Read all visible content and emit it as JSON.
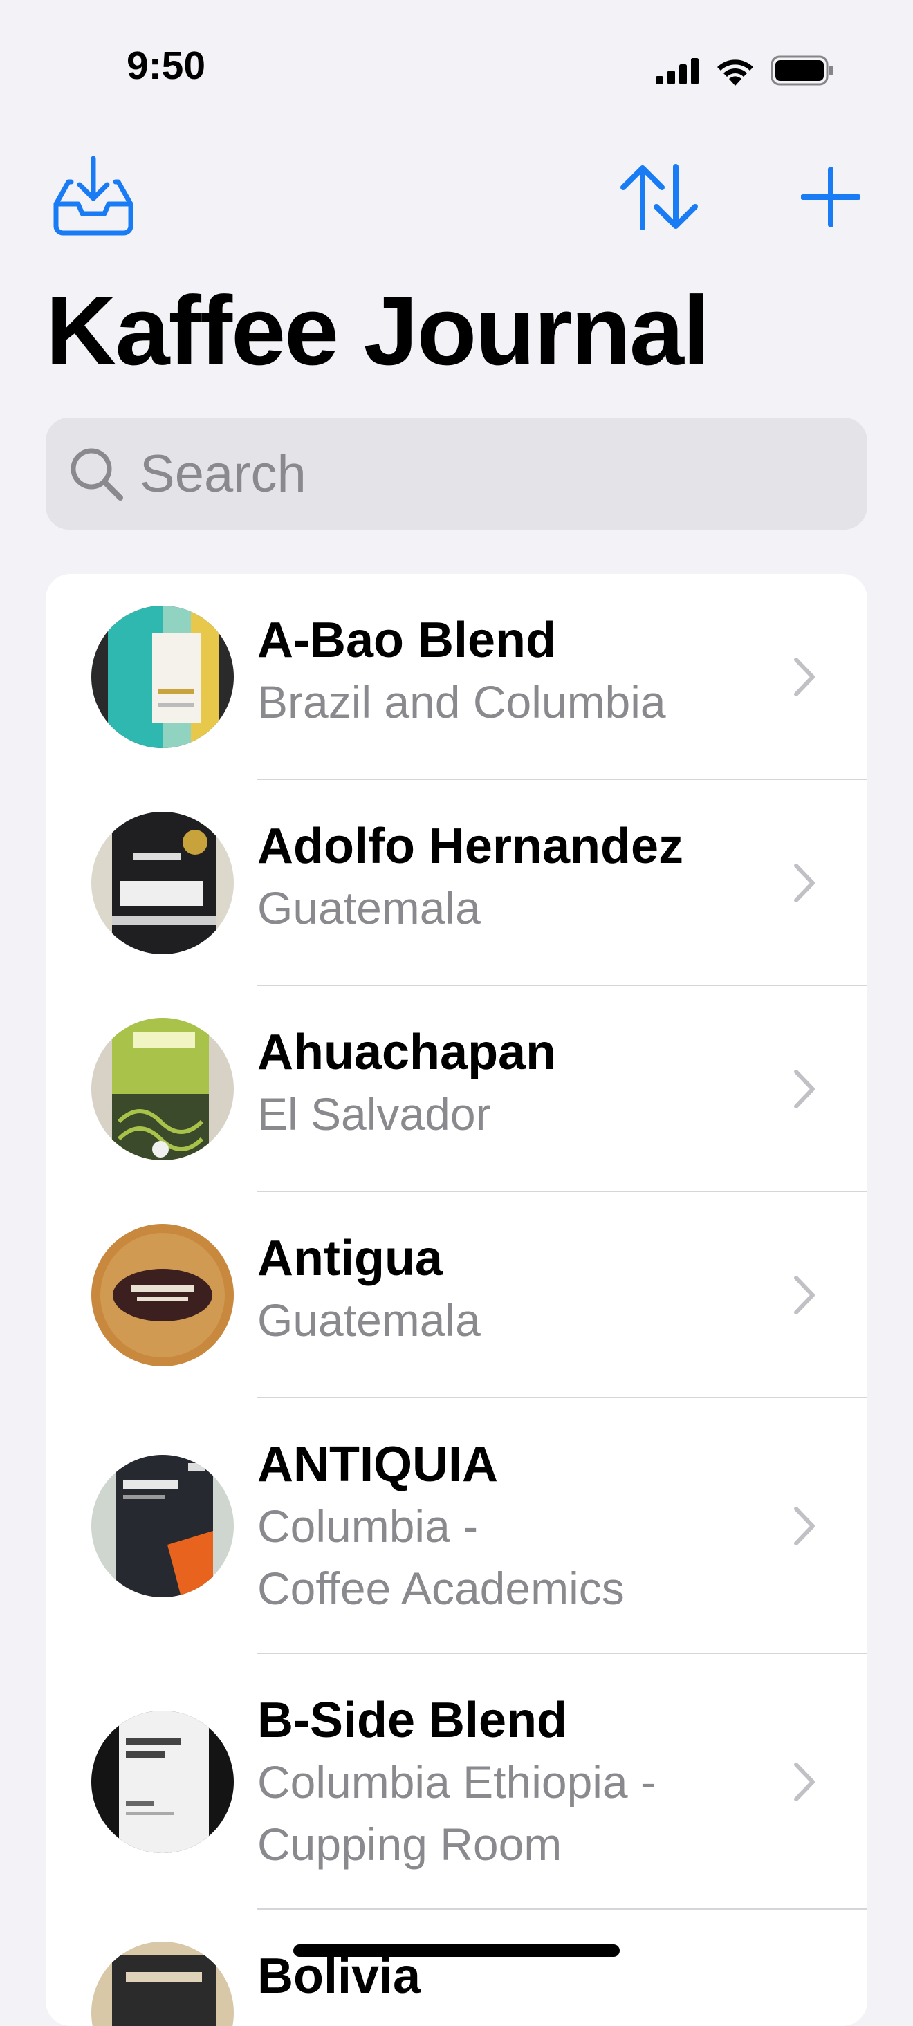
{
  "status_bar": {
    "time": "9:50"
  },
  "toolbar": {
    "import_icon": "tray-arrow-down-icon",
    "sort_icon": "arrow-up-arrow-down-icon",
    "add_icon": "plus-icon"
  },
  "title": "Kaffee Journal",
  "search": {
    "placeholder": "Search",
    "value": ""
  },
  "colors": {
    "accent": "#1a7cf5",
    "background": "#f2f2f7",
    "secondary_text": "#8a8a8e"
  },
  "coffees": [
    {
      "name": "A-Bao Blend",
      "subtitle_lines": [
        "Brazil and Columbia"
      ]
    },
    {
      "name": "Adolfo Hernandez",
      "subtitle_lines": [
        "Guatemala"
      ]
    },
    {
      "name": "Ahuachapan",
      "subtitle_lines": [
        "El Salvador"
      ]
    },
    {
      "name": "Antigua",
      "subtitle_lines": [
        "Guatemala"
      ]
    },
    {
      "name": "ANTIQUIA",
      "subtitle_lines": [
        "Columbia -",
        "Coffee Academics"
      ]
    },
    {
      "name": "B-Side Blend",
      "subtitle_lines": [
        "Columbia Ethiopia -",
        "Cupping Room"
      ]
    },
    {
      "name": "Bolivia",
      "subtitle_lines": []
    }
  ]
}
